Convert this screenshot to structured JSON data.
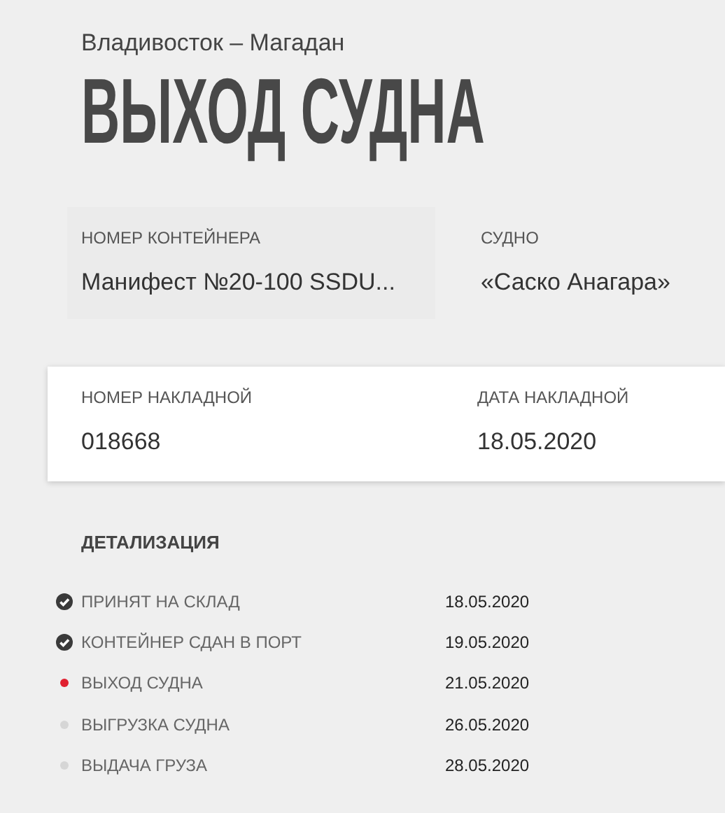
{
  "route": "Владивосток – Магадан",
  "title": "ВЫХОД СУДНА",
  "info": [
    {
      "label": "НОМЕР КОНТЕЙНЕРА",
      "value": "Манифест №20-100 SSDU..."
    },
    {
      "label": "СУДНО",
      "value": "«Саско Анагара»"
    }
  ],
  "invoice": [
    {
      "label": "НОМЕР НАКЛАДНОЙ",
      "value": "018668"
    },
    {
      "label": "ДАТА НАКЛАДНОЙ",
      "value": "18.05.2020"
    }
  ],
  "details": {
    "heading": "ДЕТАЛИЗАЦИЯ",
    "steps": [
      {
        "kind": "done",
        "label": "ПРИНЯТ НА СКЛАД",
        "date": "18.05.2020"
      },
      {
        "kind": "done",
        "label": "КОНТЕЙНЕР СДАН В ПОРТ",
        "date": "19.05.2020"
      },
      {
        "kind": "current",
        "label": "ВЫХОД СУДНА",
        "date": "21.05.2020"
      },
      {
        "kind": "pending",
        "label": "ВЫГРУЗКА СУДНА",
        "date": "26.05.2020"
      },
      {
        "kind": "pending",
        "label": "ВЫДАЧА ГРУЗА",
        "date": "28.05.2020"
      }
    ]
  }
}
